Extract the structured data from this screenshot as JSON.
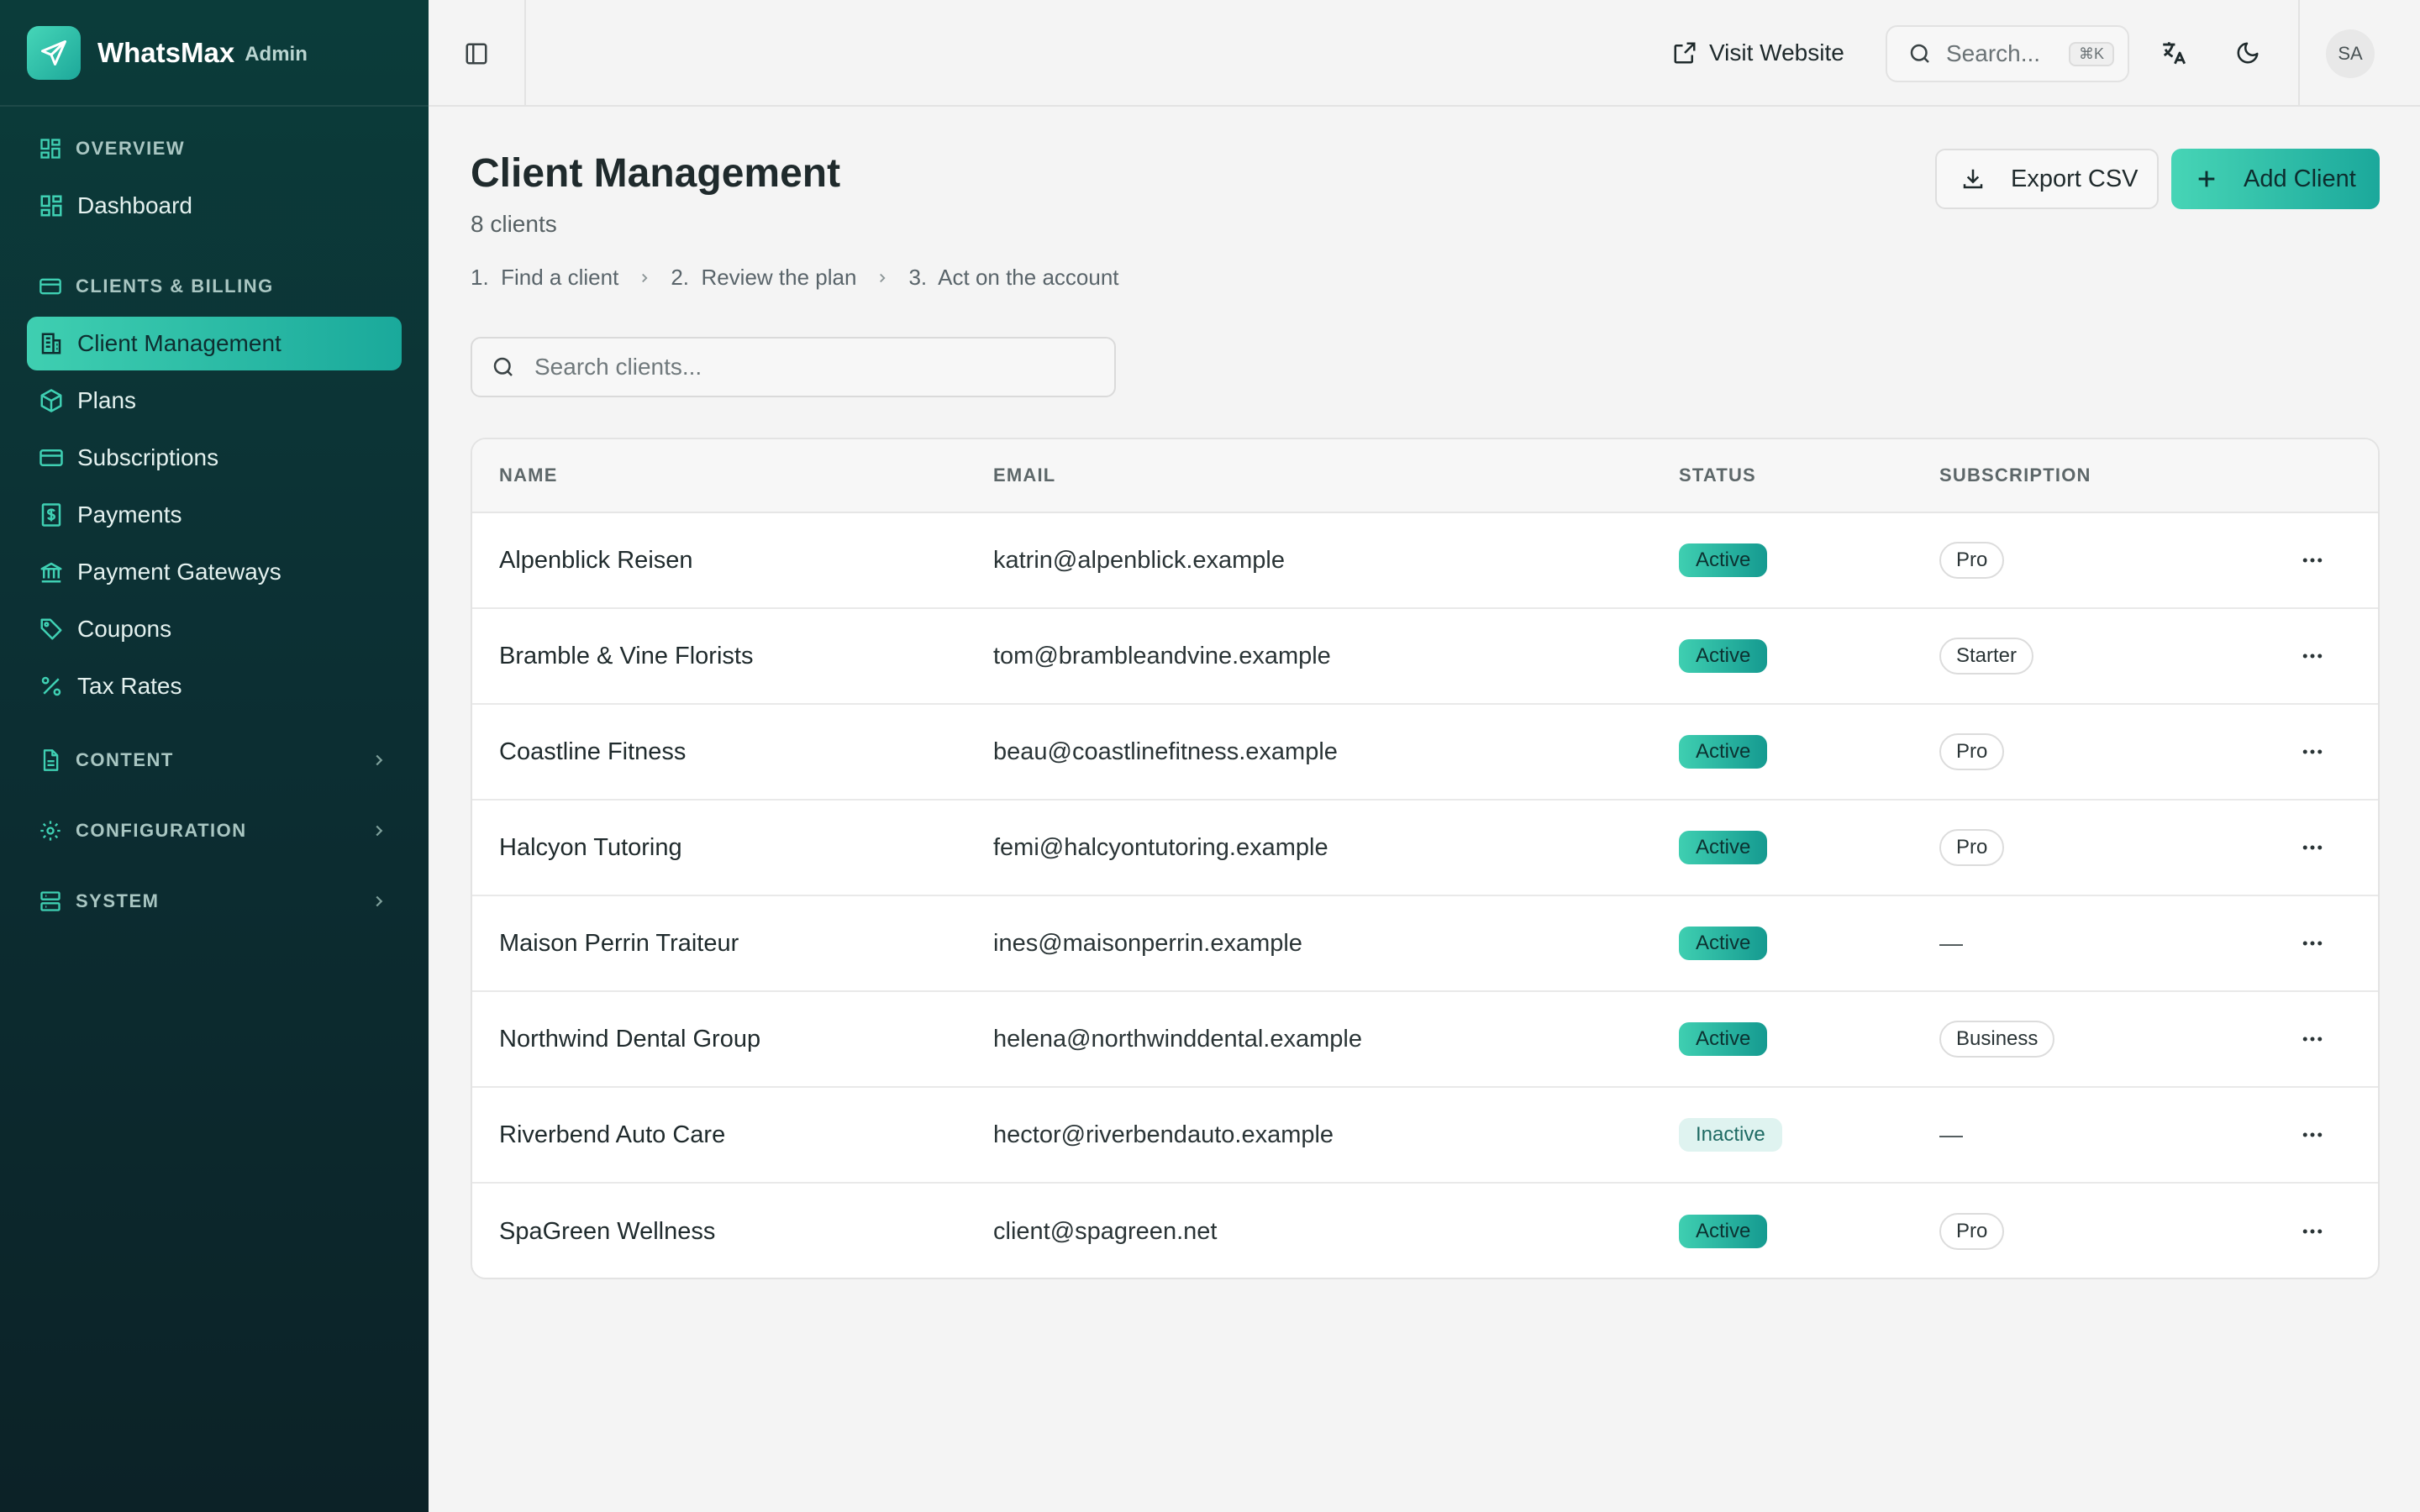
{
  "brand": {
    "name": "WhatsMax",
    "tag": "Admin"
  },
  "sidebar": {
    "sections": [
      {
        "label": "OVERVIEW",
        "items": [
          {
            "label": "Dashboard",
            "icon": "dashboard-icon"
          }
        ]
      },
      {
        "label": "CLIENTS & BILLING",
        "items": [
          {
            "label": "Client Management",
            "icon": "building-icon",
            "active": true
          },
          {
            "label": "Plans",
            "icon": "package-icon"
          },
          {
            "label": "Subscriptions",
            "icon": "credit-card-icon"
          },
          {
            "label": "Payments",
            "icon": "receipt-icon"
          },
          {
            "label": "Payment Gateways",
            "icon": "bank-icon"
          },
          {
            "label": "Coupons",
            "icon": "tag-icon"
          },
          {
            "label": "Tax Rates",
            "icon": "percent-icon"
          }
        ]
      },
      {
        "label": "CONTENT",
        "collapsed": true
      },
      {
        "label": "CONFIGURATION",
        "collapsed": true
      },
      {
        "label": "SYSTEM",
        "collapsed": true
      }
    ]
  },
  "topbar": {
    "visit_label": "Visit Website",
    "search_placeholder": "Search...",
    "search_shortcut": "⌘K",
    "avatar_initials": "SA"
  },
  "page": {
    "title": "Client Management",
    "subtitle": "8 clients",
    "steps": [
      "1.  Find a client",
      "2.  Review the plan",
      "3.  Act on the account"
    ],
    "export_label": "Export CSV",
    "add_label": "Add Client",
    "search_placeholder": "Search clients..."
  },
  "table": {
    "headers": [
      "NAME",
      "EMAIL",
      "STATUS",
      "SUBSCRIPTION"
    ],
    "rows": [
      {
        "name": "Alpenblick Reisen",
        "email": "katrin@alpenblick.example",
        "status": "Active",
        "subscription": "Pro"
      },
      {
        "name": "Bramble & Vine Florists",
        "email": "tom@brambleandvine.example",
        "status": "Active",
        "subscription": "Starter"
      },
      {
        "name": "Coastline Fitness",
        "email": "beau@coastlinefitness.example",
        "status": "Active",
        "subscription": "Pro"
      },
      {
        "name": "Halcyon Tutoring",
        "email": "femi@halcyontutoring.example",
        "status": "Active",
        "subscription": "Pro"
      },
      {
        "name": "Maison Perrin Traiteur",
        "email": "ines@maisonperrin.example",
        "status": "Active",
        "subscription": "—"
      },
      {
        "name": "Northwind Dental Group",
        "email": "helena@northwinddental.example",
        "status": "Active",
        "subscription": "Business"
      },
      {
        "name": "Riverbend Auto Care",
        "email": "hector@riverbendauto.example",
        "status": "Inactive",
        "subscription": "—"
      },
      {
        "name": "SpaGreen Wellness",
        "email": "client@spagreen.net",
        "status": "Active",
        "subscription": "Pro"
      }
    ]
  },
  "colors": {
    "accent": "#2ec4a8",
    "sidebar_bg": "#0c2f33",
    "page_bg": "#f4f4f4"
  }
}
